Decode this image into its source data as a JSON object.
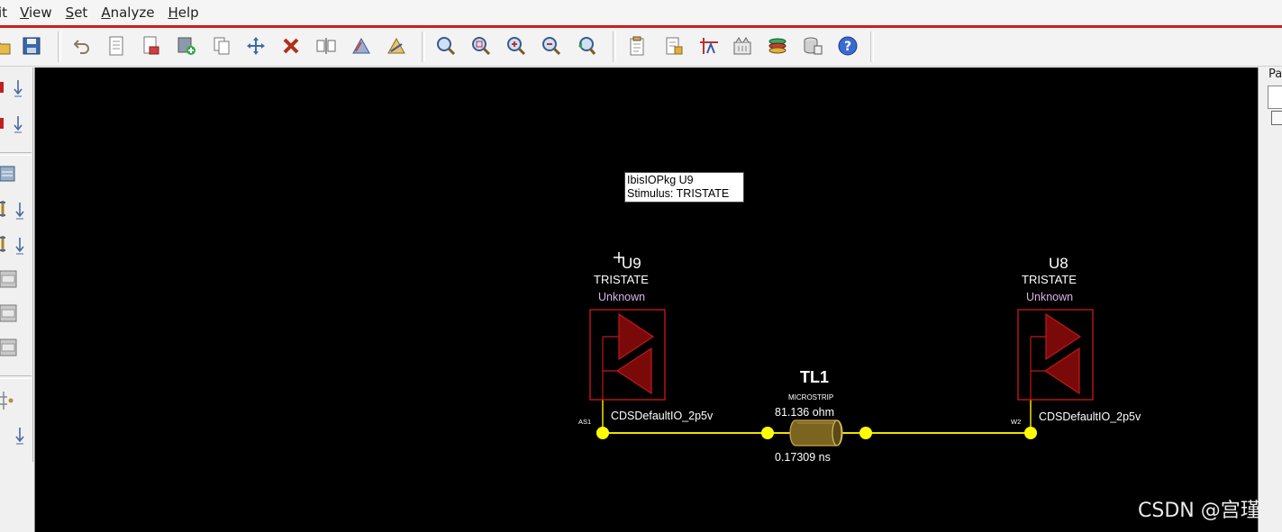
{
  "menu": {
    "items": [
      "it",
      "View",
      "Set",
      "Analyze",
      "Help"
    ]
  },
  "toolbar": {
    "groups": [
      [
        "open-icon",
        "save-icon"
      ],
      [
        "undo-icon",
        "new-icon",
        "erase-icon",
        "add-icon",
        "copy-icon",
        "move-icon",
        "delete-icon",
        "mirror-icon",
        "rotate-icon",
        "flip-icon"
      ],
      [
        "zoom-fit-icon",
        "zoom-area-icon",
        "zoom-in-icon",
        "zoom-out-icon",
        "zoom-previous-icon"
      ],
      [
        "parameters-icon",
        "properties-icon",
        "measure-icon",
        "library-icon",
        "stack-icon",
        "database-icon",
        "help-icon"
      ]
    ]
  },
  "palette": {
    "items": [
      "ibis-io-icon",
      "ibis-io-icon",
      "package-icon",
      "tline-icon",
      "tline-icon",
      "connector-icon",
      "connector-icon",
      "connector-icon",
      "component-icon"
    ]
  },
  "schematic": {
    "u9": {
      "ref": "U9",
      "mode": "TRISTATE",
      "state": "Unknown",
      "model": "CDSDefaultIO_2p5v",
      "pin": "AS1"
    },
    "u8": {
      "ref": "U8",
      "mode": "TRISTATE",
      "state": "Unknown",
      "model": "CDSDefaultIO_2p5v",
      "pin": "W2"
    },
    "tl1": {
      "ref": "TL1",
      "type": "MICROSTRIP",
      "impedance": "81.136 ohm",
      "delay": "0.17309 ns"
    },
    "colors": {
      "wire": "#f0e000",
      "node": "#ffff00",
      "buffer_outline": "#c01818",
      "buffer_fill": "#7a0a0a",
      "state_text": "#d9b3e6",
      "tline_fill": "#7a6420"
    }
  },
  "tooltip": {
    "line1": "IbisIOPkg U9",
    "line2": "Stimulus: TRISTATE"
  },
  "right_panel": {
    "tab_label": "Pa"
  },
  "watermark": "CSDN @宫瑾"
}
